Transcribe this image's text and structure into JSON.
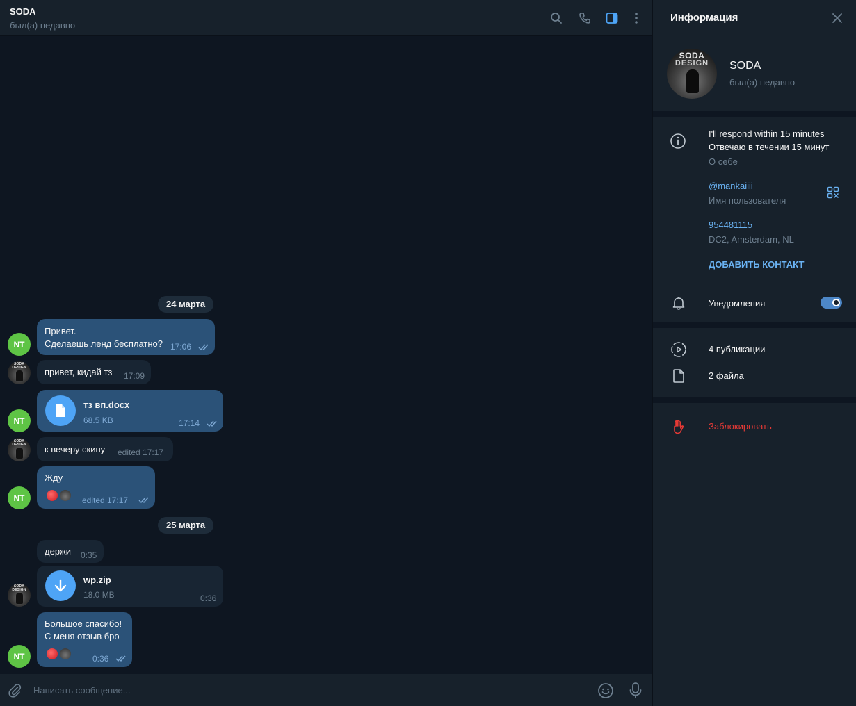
{
  "chat": {
    "title": "SODA",
    "status": "был(а) недавно",
    "composer_placeholder": "Написать сообщение..."
  },
  "dates": [
    "24 марта",
    "25 марта"
  ],
  "messages": [
    {
      "id": "m1",
      "direction": "out",
      "sender_avatar": "NT",
      "text": "Привет.\nСделаешь ленд бесплатно?",
      "time": "17:06",
      "read": true
    },
    {
      "id": "m2",
      "direction": "in",
      "text": "привет, кидай тз",
      "time": "17:09"
    },
    {
      "id": "m3",
      "direction": "out",
      "sender_avatar": "NT",
      "type": "file",
      "file_name": "тз вп.docx",
      "file_size": "68.5 KB",
      "time": "17:14",
      "read": true
    },
    {
      "id": "m4",
      "direction": "in",
      "text": "к вечеру скину",
      "time": "edited 17:17"
    },
    {
      "id": "m5",
      "direction": "out",
      "sender_avatar": "NT",
      "text": "Жду",
      "time": "edited 17:17",
      "read": true,
      "reactions": [
        "heart",
        "soda-avatar"
      ]
    },
    {
      "id": "m6",
      "direction": "in",
      "text": "держи",
      "time": "0:35"
    },
    {
      "id": "m7",
      "direction": "in",
      "type": "file",
      "file_name": "wp.zip",
      "file_size": "18.0 MB",
      "time": "0:36"
    },
    {
      "id": "m8",
      "direction": "out",
      "sender_avatar": "NT",
      "text": "Большое спасибо!\nС меня отзыв бро",
      "time": "0:36",
      "read": true,
      "reactions": [
        "heart",
        "soda-avatar"
      ]
    }
  ],
  "info": {
    "title": "Информация",
    "profile_name": "SODA",
    "profile_status": "был(а) недавно",
    "avatar_text_line1": "SODA",
    "avatar_text_line2": "DESIGN",
    "bio_line1": "I'll respond within 15 minutes",
    "bio_line2": "Отвечаю в течении 15 минут",
    "bio_label": "О себе",
    "username": "@mankaiiii",
    "username_label": "Имя пользователя",
    "user_id": "954481115",
    "dc": "DC2, Amsterdam, NL",
    "add_contact": "ДОБАВИТЬ КОНТАКТ",
    "notifications_label": "Уведомления",
    "notifications_on": true,
    "publications": "4 публикации",
    "files": "2 файла",
    "block": "Заблокировать"
  },
  "colors": {
    "bg": "#0e1621",
    "panel": "#17212b",
    "bubble_out": "#2b5278",
    "bubble_in": "#182533",
    "accent": "#6ab2f2",
    "danger": "#e53935",
    "avatar_nt": "#5ec445"
  },
  "icons": [
    "search-icon",
    "phone-icon",
    "sidebar-toggle-icon",
    "more-icon",
    "close-icon",
    "info-icon",
    "qr-code-icon",
    "bell-icon",
    "publications-icon",
    "file-icon",
    "hand-block-icon",
    "attach-icon",
    "emoji-icon",
    "microphone-icon",
    "download-icon",
    "read-checks-icon"
  ]
}
